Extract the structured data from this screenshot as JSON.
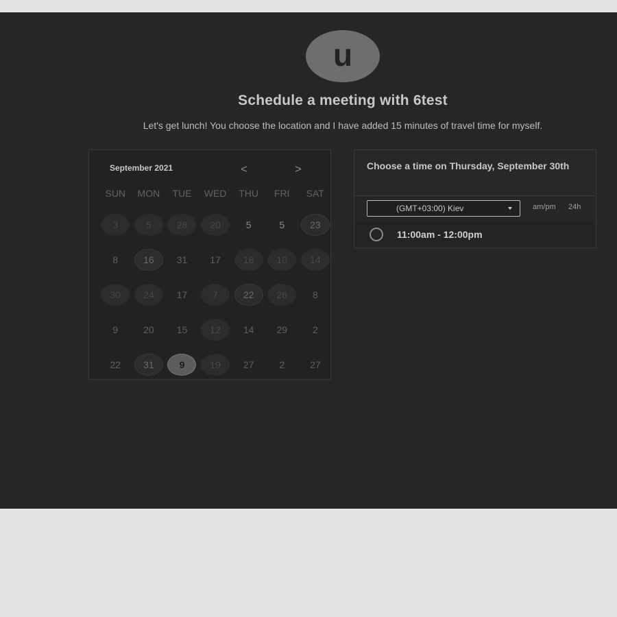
{
  "avatar": {
    "initial": "u"
  },
  "header": {
    "title": "Schedule a meeting with 6test",
    "subtitle": "Let's get lunch! You choose the location and I have added 15 minutes of travel time for myself."
  },
  "calendar": {
    "month_label": "September 2021",
    "prev_icon": "chevron-left-icon",
    "next_icon": "chevron-right-icon",
    "prev_glyph": "<",
    "next_glyph": ">",
    "weekdays": [
      "SUN",
      "MON",
      "TUE",
      "WED",
      "THU",
      "FRI",
      "SAT"
    ],
    "weeks": [
      [
        "3",
        "5",
        "28",
        "20",
        "5",
        "5",
        "23"
      ],
      [
        "8",
        "16",
        "31",
        "17",
        "18",
        "10",
        "14"
      ],
      [
        "30",
        "24",
        "17",
        "7",
        "22",
        "26",
        "8"
      ],
      [
        "9",
        "20",
        "15",
        "12",
        "14",
        "29",
        "2"
      ],
      [
        "22",
        "31",
        "9",
        "19",
        "27",
        "2",
        "27"
      ]
    ],
    "selected": "9"
  },
  "times": {
    "heading": "Choose a time on Thursday, September 30th",
    "timezone": "(GMT+03:00) Kiev",
    "format_ampm": "am/pm",
    "format_24h": "24h",
    "slots": [
      {
        "label": "11:00am - 12:00pm"
      }
    ]
  }
}
